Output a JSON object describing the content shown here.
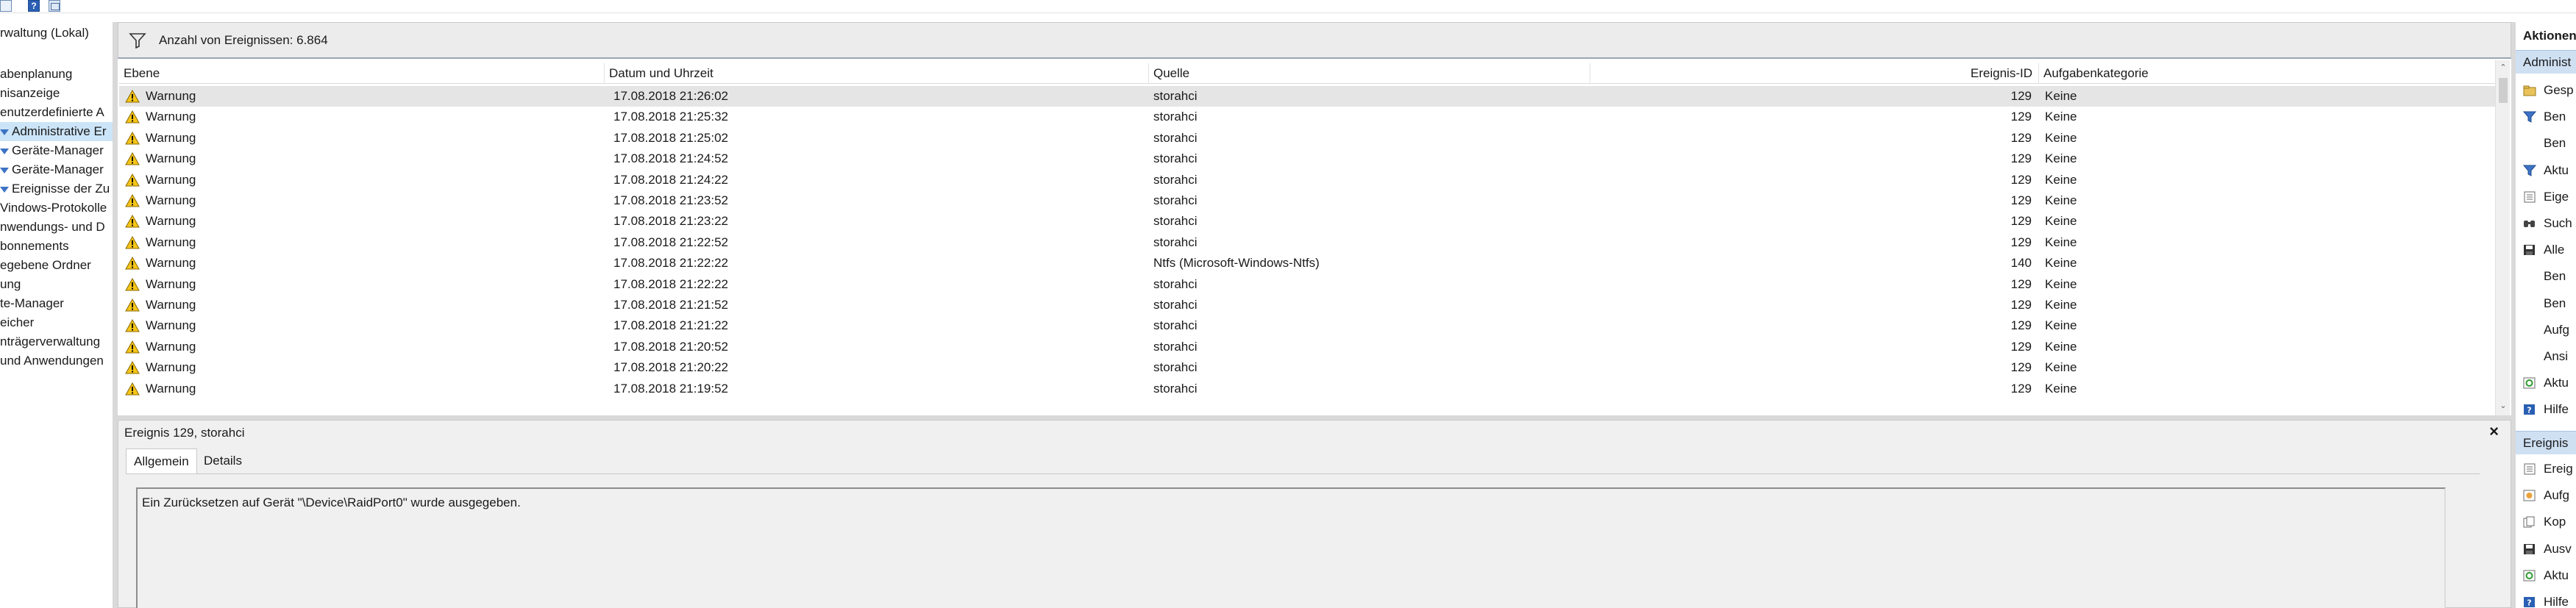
{
  "toolbar": {
    "icons": [
      "properties-icon",
      "help-icon",
      "panel-icon"
    ],
    "help_glyph": "?"
  },
  "tree": {
    "items": [
      {
        "label": "rwaltung (Lokal)",
        "selected": false,
        "icon": "none"
      },
      {
        "label": "abenplanung",
        "selected": false,
        "icon": "none"
      },
      {
        "label": "nisanzeige",
        "selected": false,
        "icon": "none"
      },
      {
        "label": "enutzerdefinierte A",
        "selected": false,
        "icon": "none"
      },
      {
        "label": "Administrative Er",
        "selected": true,
        "icon": "filter-icon"
      },
      {
        "label": "Geräte-Manager",
        "selected": false,
        "icon": "filter-icon"
      },
      {
        "label": "Geräte-Manager",
        "selected": false,
        "icon": "filter-icon"
      },
      {
        "label": "Ereignisse der Zu",
        "selected": false,
        "icon": "filter-icon"
      },
      {
        "label": "Vindows-Protokolle",
        "selected": false,
        "icon": "none"
      },
      {
        "label": "nwendungs- und D",
        "selected": false,
        "icon": "none"
      },
      {
        "label": "bonnements",
        "selected": false,
        "icon": "none"
      },
      {
        "label": "egebene Ordner",
        "selected": false,
        "icon": "none"
      },
      {
        "label": "ung",
        "selected": false,
        "icon": "none"
      },
      {
        "label": "te-Manager",
        "selected": false,
        "icon": "none"
      },
      {
        "label": "eicher",
        "selected": false,
        "icon": "none"
      },
      {
        "label": "nträgerverwaltung",
        "selected": false,
        "icon": "none"
      },
      {
        "label": "und Anwendungen",
        "selected": false,
        "icon": "none"
      }
    ]
  },
  "summary": {
    "count_label": "Anzahl von Ereignissen: 6.864"
  },
  "grid": {
    "columns": [
      "Ebene",
      "Datum und Uhrzeit",
      "Quelle",
      "Ereignis-ID",
      "Aufgabenkategorie"
    ],
    "rows": [
      {
        "level": "Warnung",
        "datetime": "17.08.2018 21:26:02",
        "source": "storahci",
        "event_id": "129",
        "category": "Keine"
      },
      {
        "level": "Warnung",
        "datetime": "17.08.2018 21:25:32",
        "source": "storahci",
        "event_id": "129",
        "category": "Keine"
      },
      {
        "level": "Warnung",
        "datetime": "17.08.2018 21:25:02",
        "source": "storahci",
        "event_id": "129",
        "category": "Keine"
      },
      {
        "level": "Warnung",
        "datetime": "17.08.2018 21:24:52",
        "source": "storahci",
        "event_id": "129",
        "category": "Keine"
      },
      {
        "level": "Warnung",
        "datetime": "17.08.2018 21:24:22",
        "source": "storahci",
        "event_id": "129",
        "category": "Keine"
      },
      {
        "level": "Warnung",
        "datetime": "17.08.2018 21:23:52",
        "source": "storahci",
        "event_id": "129",
        "category": "Keine"
      },
      {
        "level": "Warnung",
        "datetime": "17.08.2018 21:23:22",
        "source": "storahci",
        "event_id": "129",
        "category": "Keine"
      },
      {
        "level": "Warnung",
        "datetime": "17.08.2018 21:22:52",
        "source": "storahci",
        "event_id": "129",
        "category": "Keine"
      },
      {
        "level": "Warnung",
        "datetime": "17.08.2018 21:22:22",
        "source": "Ntfs (Microsoft-Windows-Ntfs)",
        "event_id": "140",
        "category": "Keine"
      },
      {
        "level": "Warnung",
        "datetime": "17.08.2018 21:22:22",
        "source": "storahci",
        "event_id": "129",
        "category": "Keine"
      },
      {
        "level": "Warnung",
        "datetime": "17.08.2018 21:21:52",
        "source": "storahci",
        "event_id": "129",
        "category": "Keine"
      },
      {
        "level": "Warnung",
        "datetime": "17.08.2018 21:21:22",
        "source": "storahci",
        "event_id": "129",
        "category": "Keine"
      },
      {
        "level": "Warnung",
        "datetime": "17.08.2018 21:20:52",
        "source": "storahci",
        "event_id": "129",
        "category": "Keine"
      },
      {
        "level": "Warnung",
        "datetime": "17.08.2018 21:20:22",
        "source": "storahci",
        "event_id": "129",
        "category": "Keine"
      },
      {
        "level": "Warnung",
        "datetime": "17.08.2018 21:19:52",
        "source": "storahci",
        "event_id": "129",
        "category": "Keine"
      }
    ],
    "scroll_up_glyph": "⌃",
    "scroll_down_glyph": "⌄"
  },
  "detail": {
    "title": "Ereignis 129, storahci",
    "close_glyph": "×",
    "tabs": [
      "Allgemein",
      "Details"
    ],
    "active_tab": "Allgemein",
    "message": "Ein Zurücksetzen auf Gerät \"\\Device\\RaidPort0\" wurde ausgegeben."
  },
  "actions": {
    "header": "Aktionen",
    "section1": "Administ",
    "section1_items": [
      {
        "label": "Gesp",
        "icon": "open-folder-icon"
      },
      {
        "label": "Ben",
        "icon": "filter-icon"
      },
      {
        "label": "Ben",
        "icon": "none"
      },
      {
        "label": "Aktu",
        "icon": "filter-icon"
      },
      {
        "label": "Eige",
        "icon": "properties-icon"
      },
      {
        "label": "Such",
        "icon": "find-icon"
      },
      {
        "label": "Alle",
        "icon": "save-icon"
      },
      {
        "label": "Ben",
        "icon": "none"
      },
      {
        "label": "Ben",
        "icon": "none"
      },
      {
        "label": "Aufg",
        "icon": "none"
      },
      {
        "label": "Ansi",
        "icon": "none"
      },
      {
        "label": "Aktu",
        "icon": "refresh-icon"
      },
      {
        "label": "Hilfe",
        "icon": "help-icon"
      }
    ],
    "section2": "Ereignis",
    "section2_items": [
      {
        "label": "Ereig",
        "icon": "properties-icon"
      },
      {
        "label": "Aufg",
        "icon": "task-icon"
      },
      {
        "label": "Kop",
        "icon": "copy-icon"
      },
      {
        "label": "Ausv",
        "icon": "save-icon"
      },
      {
        "label": "Aktu",
        "icon": "refresh-icon"
      },
      {
        "label": "Hilfe",
        "icon": "help-icon"
      }
    ]
  }
}
